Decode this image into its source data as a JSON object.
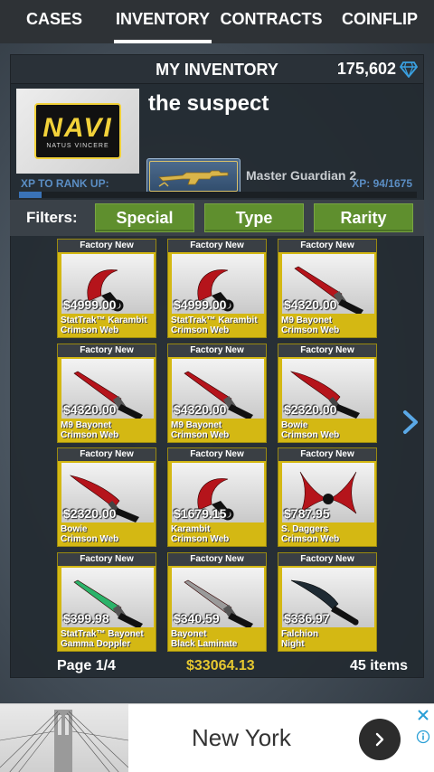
{
  "nav": {
    "tabs": [
      {
        "label": "CASES"
      },
      {
        "label": "INVENTORY"
      },
      {
        "label": "CONTRACTS"
      },
      {
        "label": "COINFLIP"
      }
    ]
  },
  "panel": {
    "title": "MY INVENTORY",
    "balance": "175,602",
    "balance_icon": "diamond-icon"
  },
  "profile": {
    "team_logo_text": "NAVI",
    "team_logo_sub": "NATUS VINCERE",
    "username": "the suspect",
    "rank_name": "Master Guardian 2",
    "xp_label": "XP TO RANK UP:",
    "xp_value": "XP: 94/1675",
    "xp_fraction": 0.056
  },
  "filters": {
    "label": "Filters:",
    "buttons": [
      {
        "label": "Special"
      },
      {
        "label": "Type"
      },
      {
        "label": "Rarity"
      }
    ]
  },
  "items": [
    {
      "condition": "Factory New",
      "price": "$4999.00",
      "name1": "StatTrak™ Karambit",
      "name2": "Crimson Web",
      "icon": "karambit-icon",
      "blade": "#b5141b"
    },
    {
      "condition": "Factory New",
      "price": "$4999.00",
      "name1": "StatTrak™ Karambit",
      "name2": "Crimson Web",
      "icon": "karambit-icon",
      "blade": "#b5141b"
    },
    {
      "condition": "Factory New",
      "price": "$4320.00",
      "name1": "M9 Bayonet",
      "name2": "Crimson Web",
      "icon": "bayonet-icon",
      "blade": "#b5141b"
    },
    {
      "condition": "Factory New",
      "price": "$4320.00",
      "name1": "M9 Bayonet",
      "name2": "Crimson Web",
      "icon": "bayonet-icon",
      "blade": "#b5141b"
    },
    {
      "condition": "Factory New",
      "price": "$4320.00",
      "name1": "M9 Bayonet",
      "name2": "Crimson Web",
      "icon": "bayonet-icon",
      "blade": "#b5141b"
    },
    {
      "condition": "Factory New",
      "price": "$2320.00",
      "name1": "Bowie",
      "name2": "Crimson Web",
      "icon": "bowie-icon",
      "blade": "#b5141b"
    },
    {
      "condition": "Factory New",
      "price": "$2320.00",
      "name1": "Bowie",
      "name2": "Crimson Web",
      "icon": "bowie-icon",
      "blade": "#b5141b"
    },
    {
      "condition": "Factory New",
      "price": "$1679.15",
      "name1": "Karambit",
      "name2": "Crimson Web",
      "icon": "karambit-icon",
      "blade": "#b5141b"
    },
    {
      "condition": "Factory New",
      "price": "$787.95",
      "name1": "S. Daggers",
      "name2": "Crimson Web",
      "icon": "daggers-icon",
      "blade": "#b5141b"
    },
    {
      "condition": "Factory New",
      "price": "$399.98",
      "name1": "StatTrak™ Bayonet",
      "name2": "Gamma Doppler",
      "icon": "bayonet-icon",
      "blade": "#2bb36a"
    },
    {
      "condition": "Factory New",
      "price": "$340.59",
      "name1": "Bayonet",
      "name2": "Black Laminate",
      "icon": "bayonet-icon",
      "blade": "#9a9a9a"
    },
    {
      "condition": "Factory New",
      "price": "$336.97",
      "name1": "Falchion",
      "name2": "Night",
      "icon": "falchion-icon",
      "blade": "#1e2a33"
    }
  ],
  "footer": {
    "page": "Page 1/4",
    "total_value": "$33064.13",
    "item_count": "45 items"
  },
  "ad": {
    "text": "New York",
    "arrow_icon": "chevron-right-icon",
    "close_icon": "close-icon",
    "info_icon": "info-icon"
  },
  "colors": {
    "accent_blue": "#3a73b8",
    "filter_green": "#5f8f2e",
    "card_gold": "#d4b813",
    "total_gold": "#e6c830"
  }
}
